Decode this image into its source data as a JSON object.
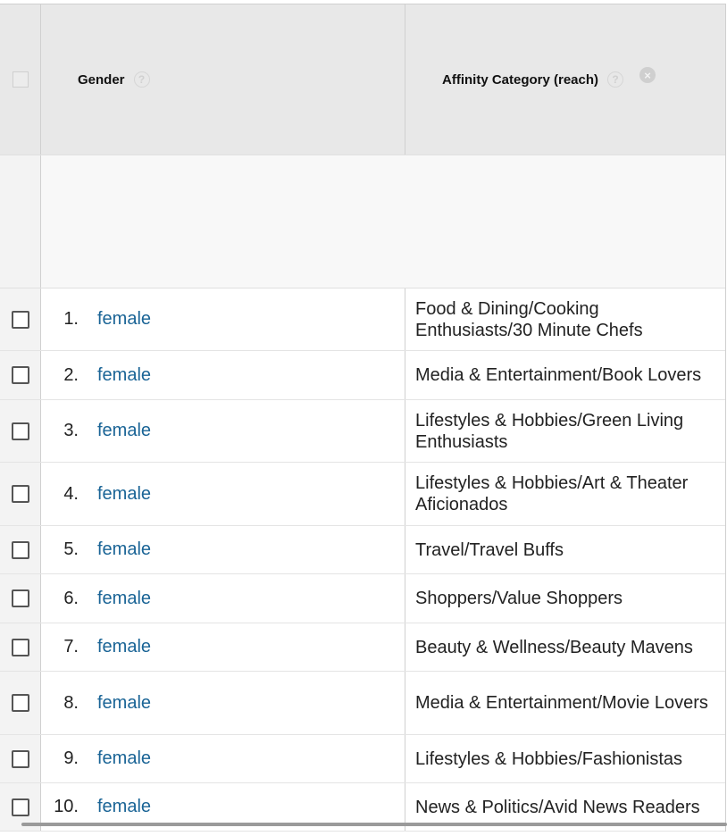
{
  "header": {
    "gender_label": "Gender",
    "affinity_label": "Affinity Category (reach)",
    "help_glyph": "?",
    "close_glyph": "×"
  },
  "rows": [
    {
      "num": "1.",
      "gender": "female",
      "affinity": "Food & Dining/Cooking Enthusiasts/30 Minute Chefs"
    },
    {
      "num": "2.",
      "gender": "female",
      "affinity": "Media & Entertainment/Book Lovers"
    },
    {
      "num": "3.",
      "gender": "female",
      "affinity": "Lifestyles & Hobbies/Green Living Enthusiasts"
    },
    {
      "num": "4.",
      "gender": "female",
      "affinity": "Lifestyles & Hobbies/Art & Theater Aficionados"
    },
    {
      "num": "5.",
      "gender": "female",
      "affinity": "Travel/Travel Buffs"
    },
    {
      "num": "6.",
      "gender": "female",
      "affinity": "Shoppers/Value Shoppers"
    },
    {
      "num": "7.",
      "gender": "female",
      "affinity": "Beauty & Wellness/Beauty Mavens"
    },
    {
      "num": "8.",
      "gender": "female",
      "affinity": "Media & Entertainment/Movie Lovers"
    },
    {
      "num": "9.",
      "gender": "female",
      "affinity": "Lifestyles & Hobbies/Fashionistas"
    },
    {
      "num": "10.",
      "gender": "female",
      "affinity": "News & Politics/Avid News Readers"
    }
  ],
  "colors": {
    "link": "#1a6496",
    "header_bg": "#e8e8e8",
    "summary_bg": "#f8f8f8"
  },
  "icons": {
    "help": "help-icon",
    "remove_dimension": "close-icon",
    "row_select": "checkbox"
  }
}
